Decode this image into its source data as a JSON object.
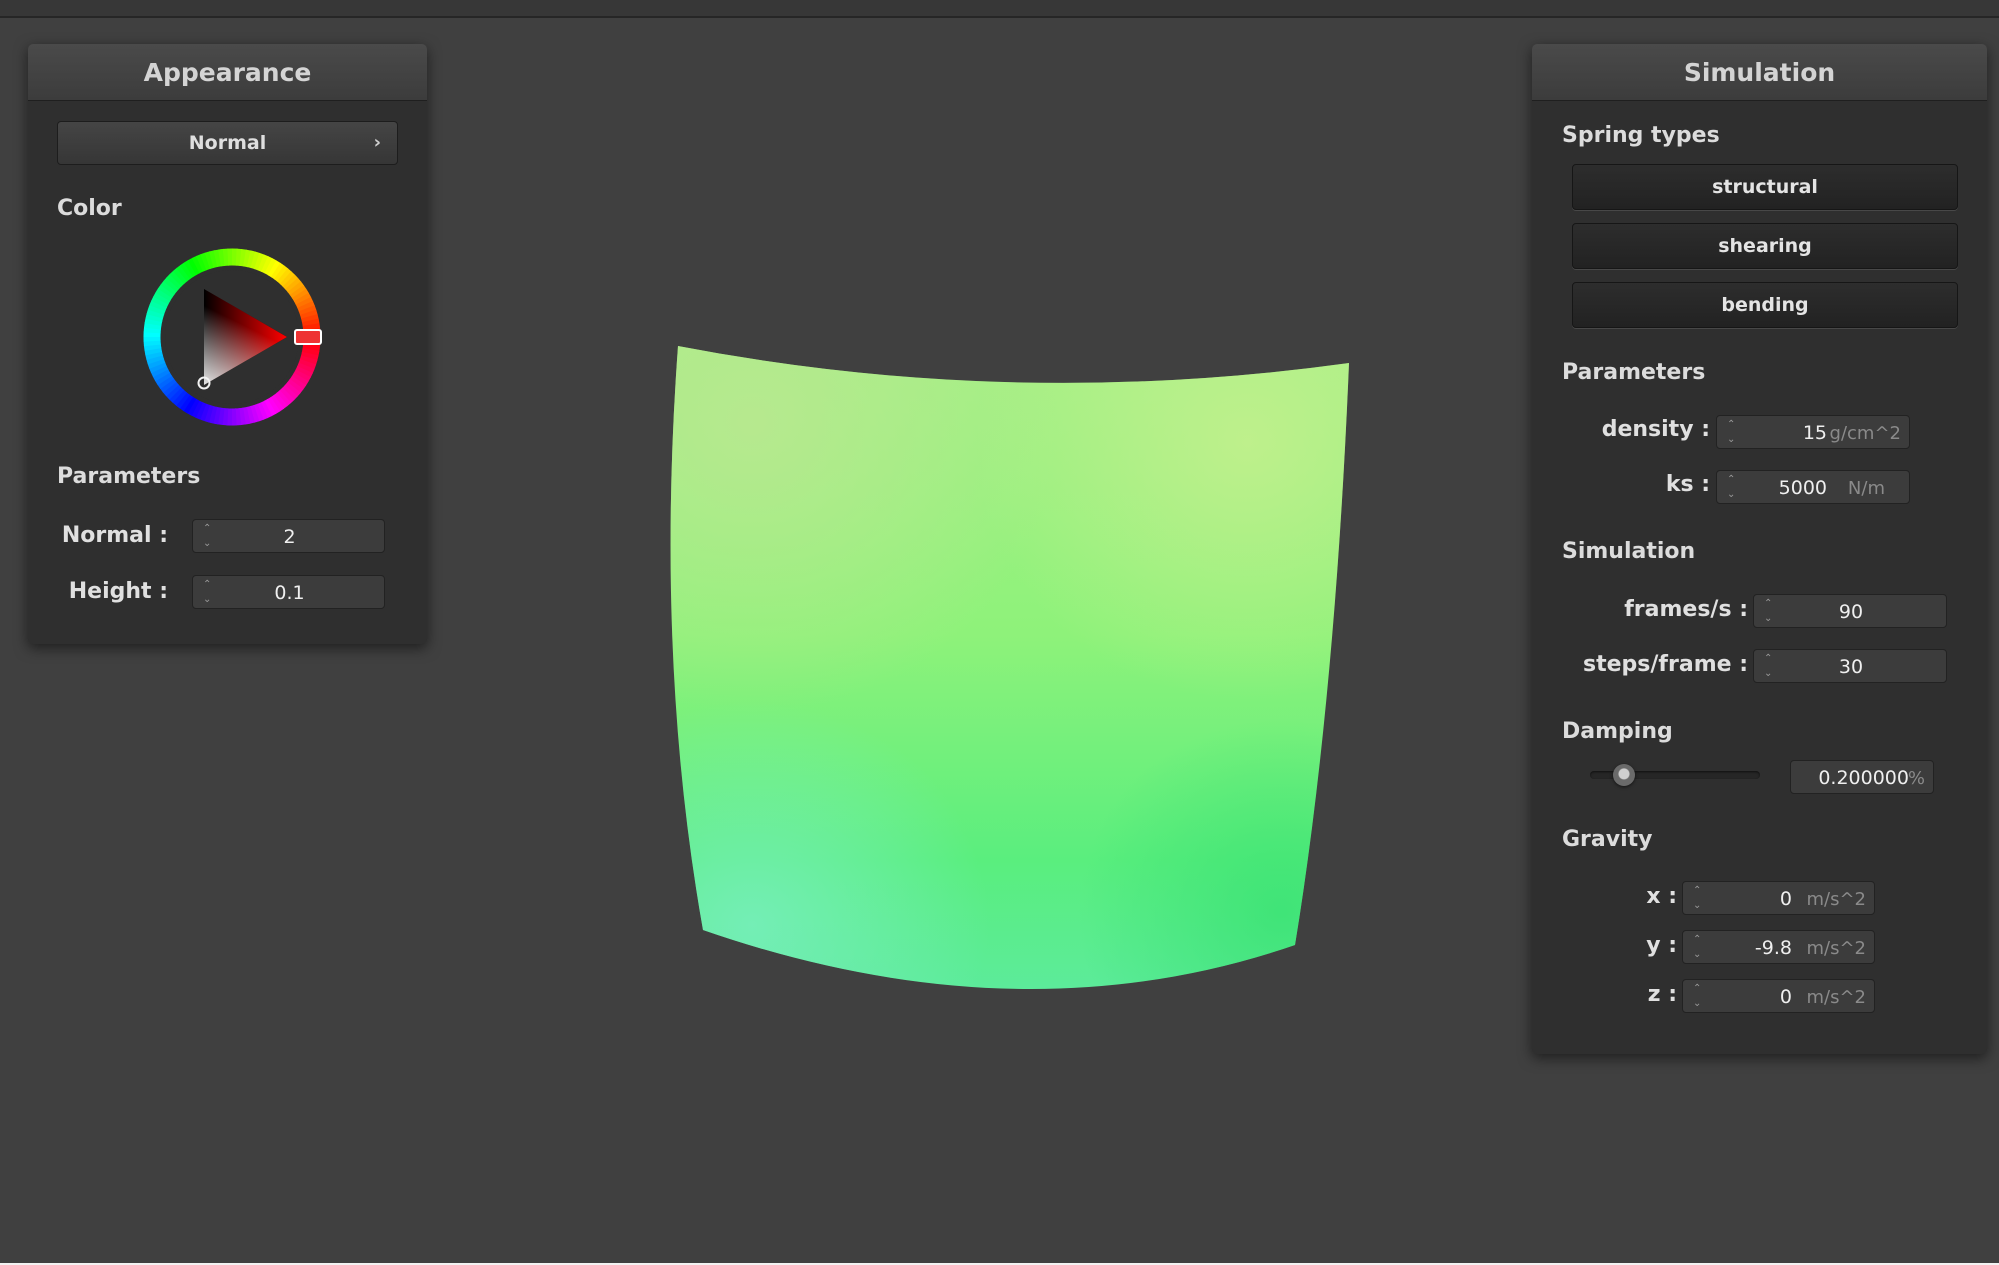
{
  "appearance": {
    "title": "Appearance",
    "shader_dropdown": "Normal",
    "color_label": "Color",
    "selected_color": "#ff0000",
    "params_label": "Parameters",
    "normal": {
      "label": "Normal :",
      "value": "2"
    },
    "height": {
      "label": "Height :",
      "value": "0.1"
    }
  },
  "simulation": {
    "title": "Simulation",
    "spring_types_label": "Spring types",
    "springs": [
      "structural",
      "shearing",
      "bending"
    ],
    "params_label": "Parameters",
    "density": {
      "label": "density :",
      "value": "15",
      "unit": "g/cm^2"
    },
    "ks": {
      "label": "ks :",
      "value": "5000",
      "unit": "N/m"
    },
    "sim_label": "Simulation",
    "fps": {
      "label": "frames/s :",
      "value": "90"
    },
    "steps": {
      "label": "steps/frame :",
      "value": "30"
    },
    "damping_label": "Damping",
    "damping": {
      "value": "0.200000",
      "unit": "%",
      "slider_fraction": 0.2
    },
    "gravity_label": "Gravity",
    "gx": {
      "label": "x :",
      "value": "0",
      "unit": "m/s^2"
    },
    "gy": {
      "label": "y :",
      "value": "-9.8",
      "unit": "m/s^2"
    },
    "gz": {
      "label": "z :",
      "value": "0",
      "unit": "m/s^2"
    }
  },
  "viewport": {
    "cloth_colors": {
      "top": "#a8f08a",
      "mid": "#7ef06a",
      "bottom": "#4ee890",
      "corner_light": "#c8f0a0"
    }
  }
}
